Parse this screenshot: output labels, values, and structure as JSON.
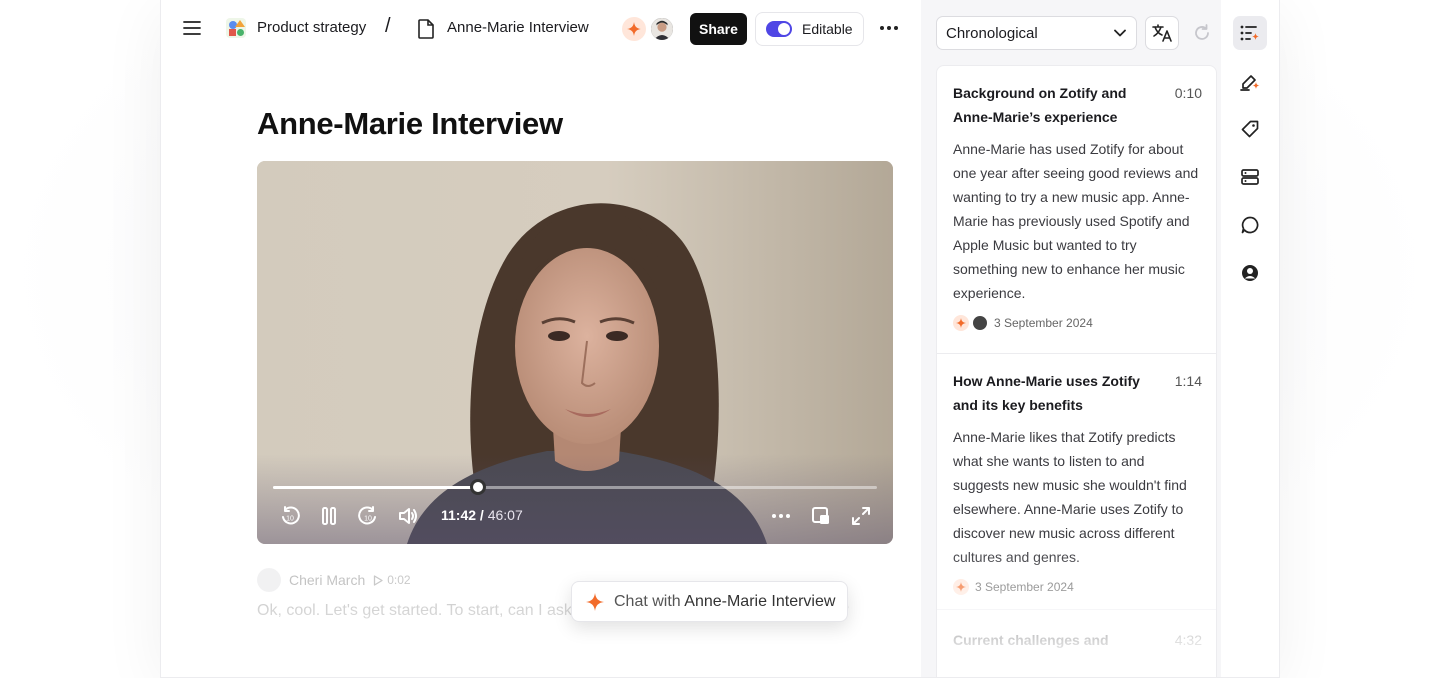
{
  "breadcrumb": {
    "project": "Product strategy",
    "separator": "/",
    "document": "Anne-Marie Interview"
  },
  "header": {
    "share_label": "Share",
    "editable_label": "Editable",
    "editable_on": true
  },
  "page": {
    "title": "Anne-Marie Interview"
  },
  "video": {
    "current_time": "11:42",
    "time_separator": " / ",
    "duration": "46:07",
    "progress_fraction": 0.339
  },
  "transcript": {
    "speaker": "Cheri March",
    "timestamp": "0:02",
    "text": "Ok, cool. Let's get started. To start, can I ask how long you've been using Zotify for?"
  },
  "chat": {
    "prefix": "Chat with",
    "document": "Anne-Marie Interview"
  },
  "panel": {
    "sort_value": "Chronological",
    "cards": [
      {
        "title": "Background on Zotify and Anne-Marie’s experience",
        "time": "0:10",
        "body": "Anne-Marie has used Zotify for about one year after seeing good reviews and wanting to try a new music app. Anne-Marie has previously used Spotify and Apple Music but wanted to try something new to enhance her music experience.",
        "date": "3 September 2024"
      },
      {
        "title": "How Anne-Marie uses Zotify and its key benefits",
        "time": "1:14",
        "body": "Anne-Marie likes that Zotify predicts what she wants to listen to and suggests new music she wouldn't find elsewhere. Anne-Marie uses Zotify to discover new music across different cultures and genres.",
        "date": "3 September 2024"
      },
      {
        "title": "Current challenges and",
        "time": "4:32",
        "body": "",
        "date": ""
      }
    ]
  },
  "colors": {
    "accent": "#4f46e5",
    "ai_orange": "#f26b2a",
    "share_bg": "#111111"
  }
}
